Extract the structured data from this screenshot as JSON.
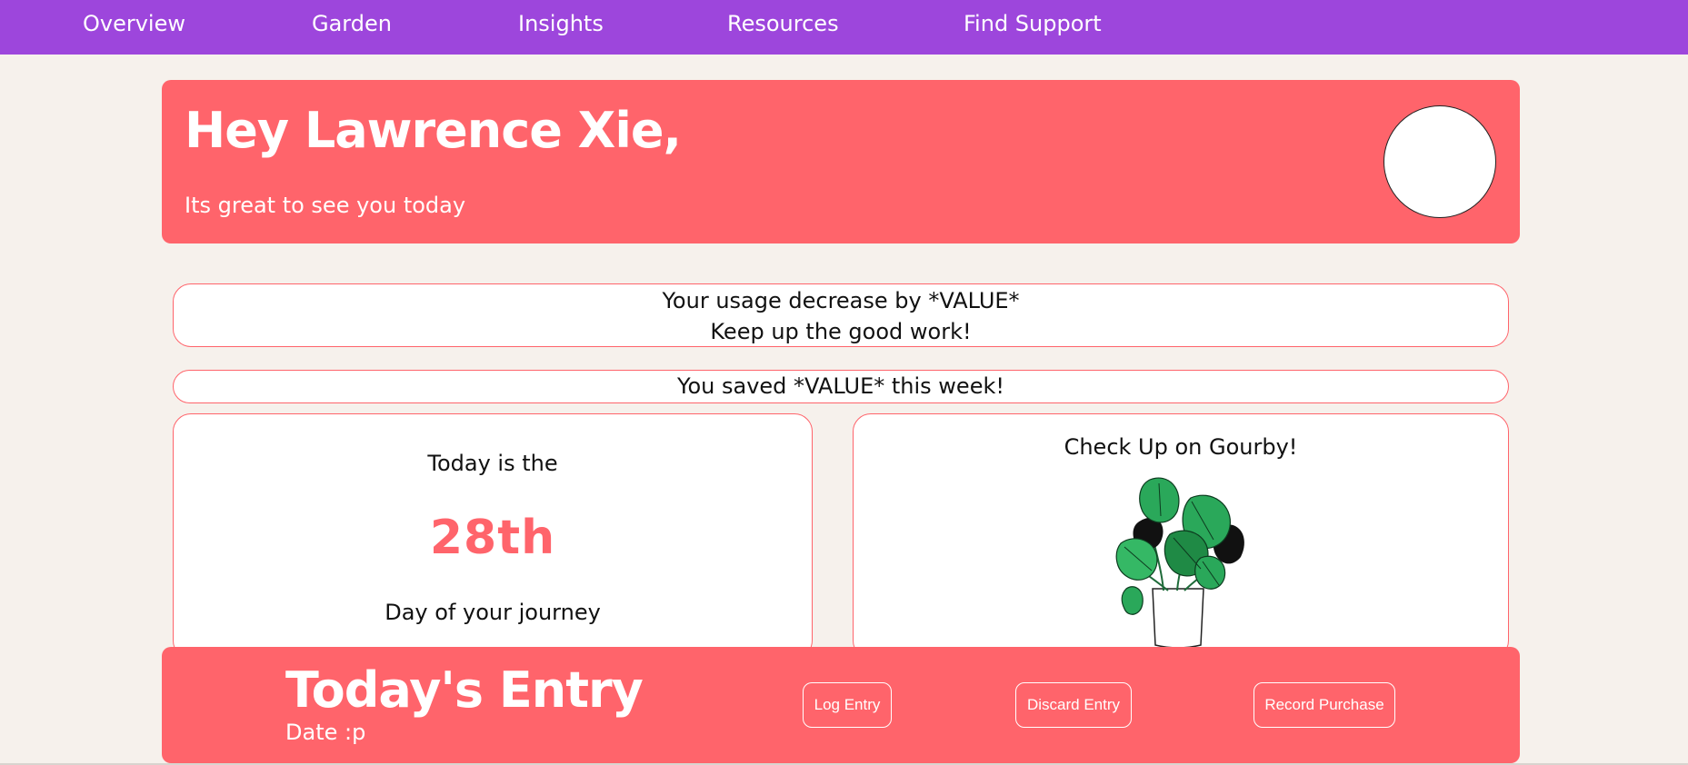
{
  "nav": {
    "items": [
      {
        "label": "Overview"
      },
      {
        "label": "Garden"
      },
      {
        "label": "Insights"
      },
      {
        "label": "Resources"
      },
      {
        "label": "Find Support"
      }
    ]
  },
  "hero": {
    "greeting": "Hey Lawrence Xie,",
    "subtitle": "Its great to see you today"
  },
  "usage_banner": {
    "line1": "Your usage decrease by *VALUE*",
    "line2": "Keep up the good work!"
  },
  "savings_banner": {
    "text": "You saved *VALUE* this week!"
  },
  "journey": {
    "pre": "Today is the",
    "day": "28th",
    "post": "Day of your journey"
  },
  "checkup": {
    "title": "Check Up on Gourby!",
    "icon": "monstera-plant-icon"
  },
  "entry": {
    "title": "Today's Entry",
    "date": "Date :p",
    "log_label": "Log Entry",
    "discard_label": "Discard Entry",
    "purchase_label": "Record Purchase"
  },
  "colors": {
    "nav": "#9d46dc",
    "accent": "#ff646b",
    "background": "#f6f1ec"
  }
}
